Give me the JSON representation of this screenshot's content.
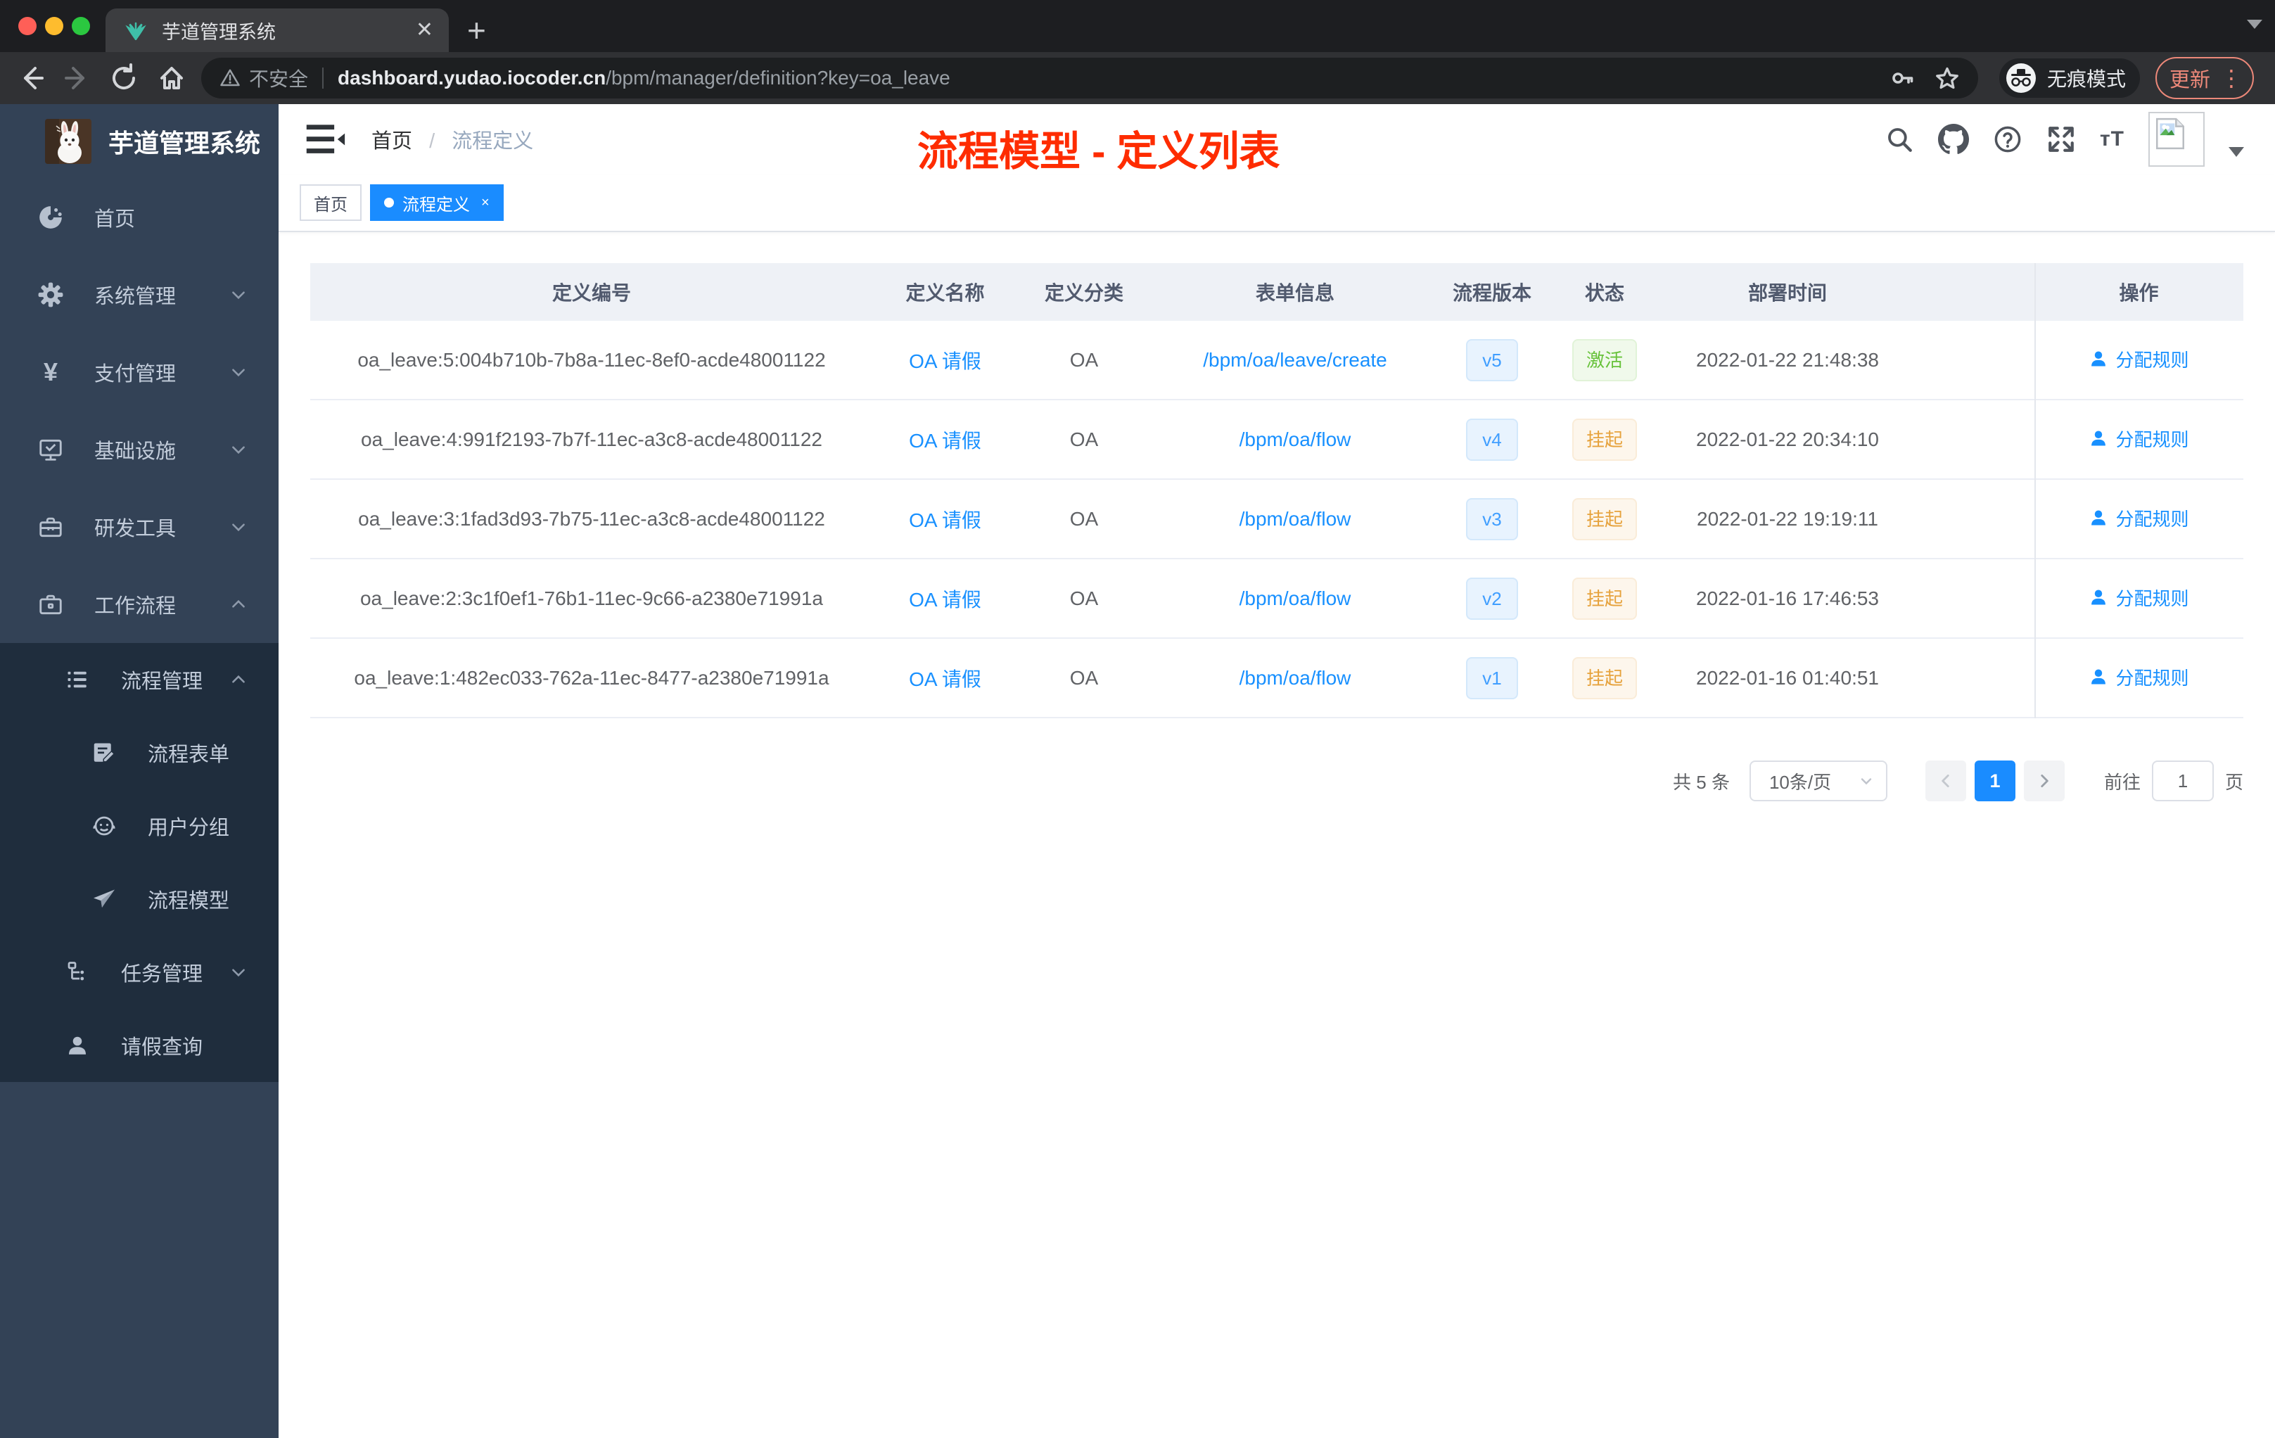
{
  "browser": {
    "tab_title": "芋道管理系统",
    "security_label": "不安全",
    "url_domain": "dashboard.yudao.iocoder.cn",
    "url_path": "/bpm/manager/definition?key=oa_leave",
    "incognito_label": "无痕模式",
    "update_label": "更新"
  },
  "sidebar": {
    "logo_title": "芋道管理系统",
    "menu": {
      "home": "首页",
      "system": "系统管理",
      "payment": "支付管理",
      "infra": "基础设施",
      "devtools": "研发工具",
      "workflow": "工作流程",
      "process_mgmt": "流程管理",
      "process_form": "流程表单",
      "user_group": "用户分组",
      "process_model": "流程模型",
      "task_mgmt": "任务管理",
      "leave_query": "请假查询"
    }
  },
  "header": {
    "breadcrumb_root": "首页",
    "breadcrumb_sep": "/",
    "breadcrumb_current": "流程定义",
    "annotation": "流程模型 - 定义列表",
    "annotation_color": "#fe2c00"
  },
  "tags": {
    "home": "首页",
    "active": "流程定义",
    "active_close": "×"
  },
  "table": {
    "columns": {
      "id": "定义编号",
      "name": "定义名称",
      "category": "定义分类",
      "form": "表单信息",
      "version": "流程版本",
      "status": "状态",
      "deploy_time": "部署时间",
      "action": "操作"
    },
    "action_label": "分配规则",
    "rows": [
      {
        "id": "oa_leave:5:004b710b-7b8a-11ec-8ef0-acde48001122",
        "name": "OA 请假",
        "category": "OA",
        "form": "/bpm/oa/leave/create",
        "version": "v5",
        "status": "激活",
        "status_type": "success",
        "time": "2022-01-22 21:48:38"
      },
      {
        "id": "oa_leave:4:991f2193-7b7f-11ec-a3c8-acde48001122",
        "name": "OA 请假",
        "category": "OA",
        "form": "/bpm/oa/flow",
        "version": "v4",
        "status": "挂起",
        "status_type": "warning",
        "time": "2022-01-22 20:34:10"
      },
      {
        "id": "oa_leave:3:1fad3d93-7b75-11ec-a3c8-acde48001122",
        "name": "OA 请假",
        "category": "OA",
        "form": "/bpm/oa/flow",
        "version": "v3",
        "status": "挂起",
        "status_type": "warning",
        "time": "2022-01-22 19:19:11"
      },
      {
        "id": "oa_leave:2:3c1f0ef1-76b1-11ec-9c66-a2380e71991a",
        "name": "OA 请假",
        "category": "OA",
        "form": "/bpm/oa/flow",
        "version": "v2",
        "status": "挂起",
        "status_type": "warning",
        "time": "2022-01-16 17:46:53"
      },
      {
        "id": "oa_leave:1:482ec033-762a-11ec-8477-a2380e71991a",
        "name": "OA 请假",
        "category": "OA",
        "form": "/bpm/oa/flow",
        "version": "v1",
        "status": "挂起",
        "status_type": "warning",
        "time": "2022-01-16 01:40:51"
      }
    ]
  },
  "pagination": {
    "total": "共 5 条",
    "page_size": "10条/页",
    "current_page": "1",
    "goto_label": "前往",
    "goto_value": "1",
    "page_unit": "页"
  }
}
